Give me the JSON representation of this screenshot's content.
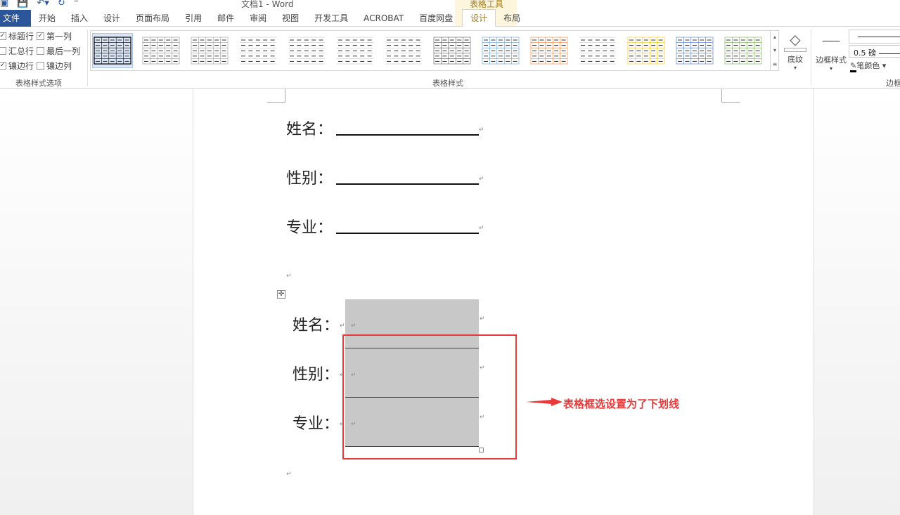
{
  "window": {
    "title": "文档1 - Word",
    "context_tab_group": "表格工具"
  },
  "tabs": [
    "文件",
    "开始",
    "插入",
    "设计",
    "页面布局",
    "引用",
    "邮件",
    "审阅",
    "视图",
    "开发工具",
    "ACROBAT",
    "百度网盘",
    "设计",
    "布局"
  ],
  "active_tab": "设计",
  "style_options": {
    "items": [
      {
        "label": "标题行",
        "checked": true
      },
      {
        "label": "第一列",
        "checked": true
      },
      {
        "label": "汇总行",
        "checked": false
      },
      {
        "label": "最后一列",
        "checked": false
      },
      {
        "label": "镶边行",
        "checked": true
      },
      {
        "label": "镶边列",
        "checked": false
      }
    ],
    "group_label": "表格样式选项"
  },
  "table_styles": {
    "group_label": "表格样式",
    "thumb_colors": [
      "#000000",
      "#888888",
      "#999999",
      "#777777",
      "#777777",
      "#888888",
      "#777777",
      "#555555",
      "#5b9bd5",
      "#ed7d31",
      "#a5a5a5",
      "#ffc000",
      "#4472c4",
      "#70ad47"
    ],
    "selected": 0
  },
  "shading": {
    "label": "底纹"
  },
  "borders": {
    "style_label": "边框样式",
    "weight": "0.5 磅",
    "pen_color_label": "笔颜色",
    "group_label": "边框"
  },
  "document": {
    "lines": [
      {
        "label": "姓名："
      },
      {
        "label": "性别："
      },
      {
        "label": "专业："
      }
    ],
    "table_rows": [
      {
        "label": "姓名："
      },
      {
        "label": "性别："
      },
      {
        "label": "专业："
      }
    ],
    "paragraph_mark": "↵"
  },
  "annotation": {
    "text": "表格框选设置为了下划线",
    "color": "#e83a3a"
  }
}
